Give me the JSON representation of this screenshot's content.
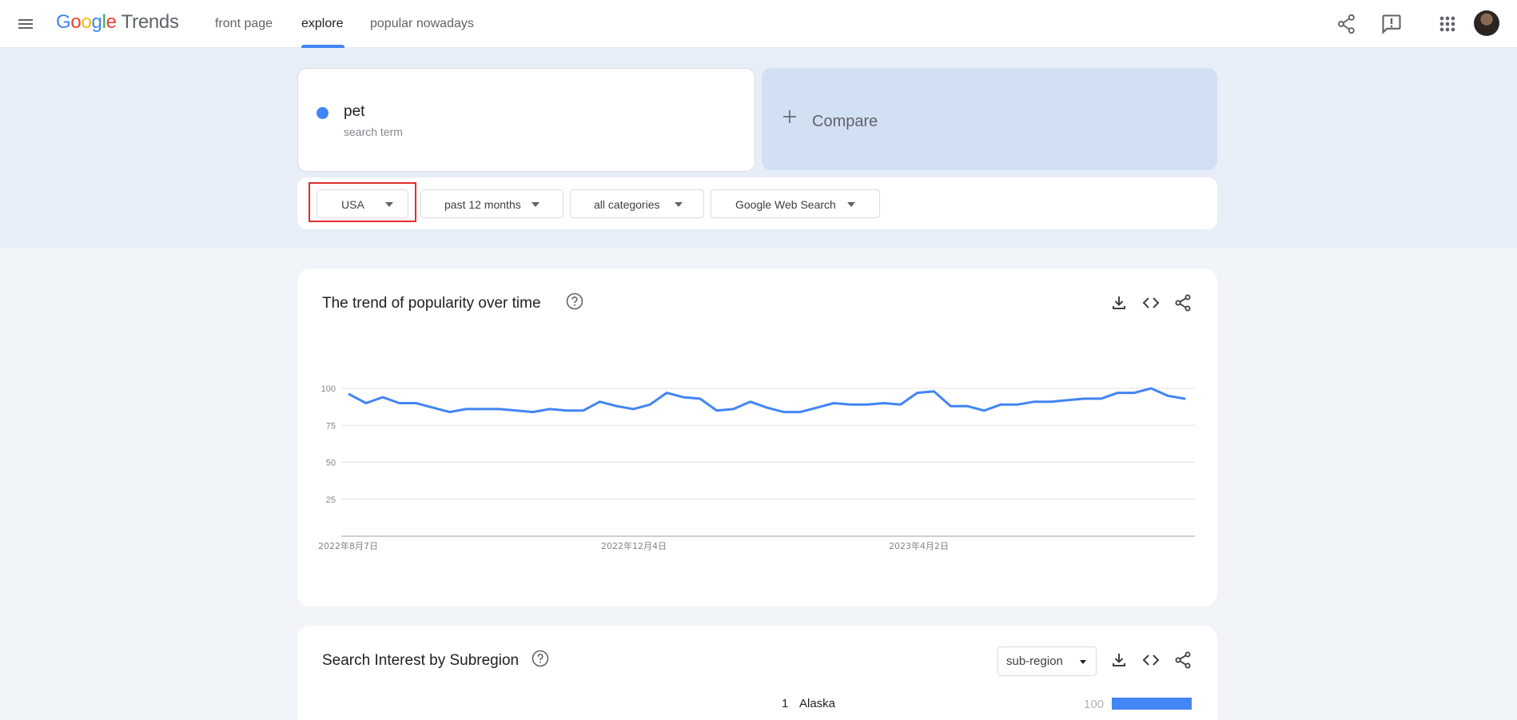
{
  "header": {
    "logo": {
      "g1": "G",
      "o1": "o",
      "o2": "o",
      "g2": "g",
      "l": "l",
      "e": "e",
      "trends": "Trends"
    },
    "nav": [
      {
        "label": "front page"
      },
      {
        "label": "explore"
      },
      {
        "label": "popular nowadays"
      }
    ],
    "active_tab": "explore",
    "icons": [
      "menu-icon",
      "share-icon",
      "feedback-icon",
      "apps-icon",
      "avatar"
    ]
  },
  "search": {
    "term": "pet",
    "term_type": "search term",
    "term_color": "#4285f4",
    "compare_label": "Compare"
  },
  "filters": {
    "region": "USA",
    "time": "past 12 months",
    "category": "all categories",
    "property": "Google Web Search"
  },
  "trend": {
    "title": "The trend of popularity over time"
  },
  "chart_data": {
    "type": "line",
    "title": "",
    "xlabel": "",
    "ylabel": "",
    "ylim": [
      0,
      100
    ],
    "yticks": [
      25,
      50,
      75,
      100
    ],
    "xtick_labels": [
      "2022年8月7日",
      "2022年12月4日",
      "2023年4月2日"
    ],
    "grid": true,
    "series": [
      {
        "color": "#4285f4",
        "values": [
          96,
          90,
          94,
          90,
          90,
          87,
          84,
          86,
          86,
          86,
          85,
          84,
          86,
          85,
          85,
          91,
          88,
          86,
          89,
          97,
          94,
          93,
          85,
          86,
          91,
          87,
          84,
          84,
          87,
          90,
          89,
          89,
          90,
          89,
          97,
          98,
          88,
          88,
          85,
          89,
          89,
          91,
          91,
          92,
          93,
          93,
          97,
          97,
          100,
          95,
          93
        ]
      }
    ]
  },
  "subregion": {
    "title": "Search Interest by Subregion",
    "select_label": "sub-region",
    "rows": [
      {
        "rank": "1",
        "name": "Alaska",
        "value": "100",
        "fraction": 1.0
      }
    ]
  },
  "colors": {
    "accent": "#4285f4",
    "highlight": "#e02e2e",
    "band": "#e8eef8",
    "compare": "#d2e0f4"
  }
}
